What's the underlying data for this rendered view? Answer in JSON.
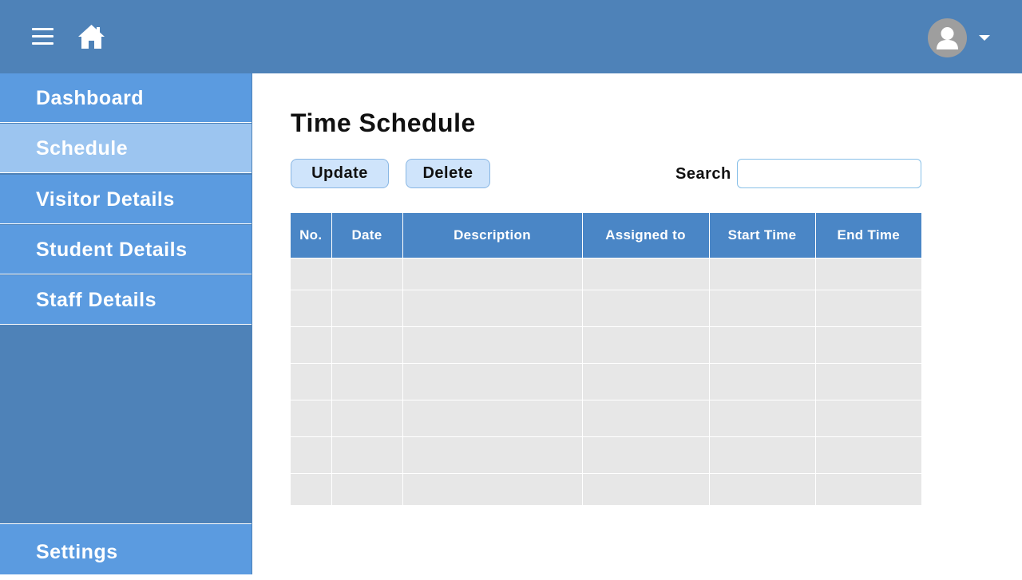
{
  "header": {
    "menu_icon": "hamburger-menu-icon",
    "home_icon": "home-icon",
    "avatar_icon": "user-avatar-icon",
    "dropdown_icon": "caret-down-icon",
    "colors": {
      "bar": "#4e82b8",
      "avatar": "#9e9e9e"
    }
  },
  "sidebar": {
    "items": [
      {
        "label": "Dashboard",
        "active": false
      },
      {
        "label": "Schedule",
        "active": true
      },
      {
        "label": "Visitor Details",
        "active": false
      },
      {
        "label": "Student Details",
        "active": false
      },
      {
        "label": "Staff Details",
        "active": false
      }
    ],
    "settings_label": "Settings",
    "colors": {
      "item": "#5b9be0",
      "active_item": "#9cc5f0",
      "background": "#4e82b8"
    }
  },
  "main": {
    "title": "Time Schedule",
    "buttons": {
      "update": "Update",
      "delete": "Delete"
    },
    "search": {
      "label": "Search",
      "value": "",
      "placeholder": ""
    },
    "table": {
      "columns": [
        "No.",
        "Date",
        "Description",
        "Assigned to",
        "Start Time",
        "End Time"
      ],
      "rows": [
        [
          "",
          "",
          "",
          "",
          "",
          ""
        ],
        [
          "",
          "",
          "",
          "",
          "",
          ""
        ],
        [
          "",
          "",
          "",
          "",
          "",
          ""
        ],
        [
          "",
          "",
          "",
          "",
          "",
          ""
        ],
        [
          "",
          "",
          "",
          "",
          "",
          ""
        ],
        [
          "",
          "",
          "",
          "",
          "",
          ""
        ],
        [
          "",
          "",
          "",
          "",
          "",
          ""
        ]
      ],
      "colors": {
        "header": "#4a86c6",
        "cell": "#e7e7e7"
      }
    }
  }
}
